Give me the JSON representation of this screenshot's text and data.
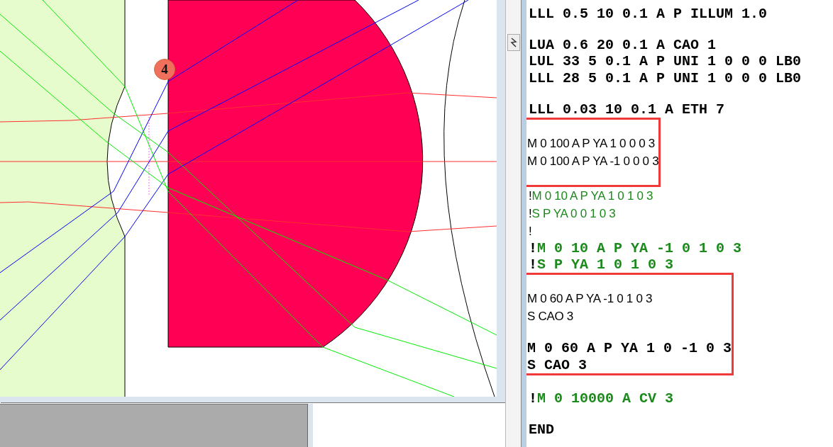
{
  "drawing_window": {
    "badge": "4"
  },
  "editor": {
    "blocks": [
      {
        "kind": "code",
        "bold": true,
        "text": "LLL 0.5 10 0.1 A P ILLUM 1.0"
      },
      {
        "kind": "blank"
      },
      {
        "kind": "code",
        "bold": true,
        "text": "LUA 0.6 20 0.1 A CAO 1"
      },
      {
        "kind": "code",
        "bold": true,
        "text": "LUL 33 5 0.1 A P UNI 1 0 0 0 LB0"
      },
      {
        "kind": "code",
        "bold": true,
        "text": "LLL 28 5 0.1 A P UNI 1 0 0 0 LB0"
      },
      {
        "kind": "blank"
      },
      {
        "kind": "code",
        "bold": true,
        "text": "LLL 0.03 10 0.1 A ETH 7"
      },
      {
        "kind": "highlight",
        "lines": [
          {
            "kind": "blank"
          },
          {
            "kind": "code",
            "bold": false,
            "text": "M 0 100 A P YA 1 0 0 0 3"
          },
          {
            "kind": "code",
            "bold": false,
            "text": "M 0 100 A P YA -1 0 0 0 3"
          },
          {
            "kind": "blank"
          }
        ]
      },
      {
        "kind": "comment",
        "bold": false,
        "prefix": "!",
        "text": "M 0 10 A P YA 1 0 1 0 3"
      },
      {
        "kind": "comment",
        "bold": false,
        "prefix": "!",
        "text": "S P YA 0 0 1 0 3"
      },
      {
        "kind": "comment",
        "bold": false,
        "prefix": "!"
      },
      {
        "kind": "comment",
        "bold": true,
        "prefix": "!",
        "text": "M 0 10 A P YA -1 0 1 0 3"
      },
      {
        "kind": "comment",
        "bold": true,
        "prefix": "!",
        "text": "S P YA 1 0 1 0 3"
      },
      {
        "kind": "highlight",
        "lines": [
          {
            "kind": "blank"
          },
          {
            "kind": "code",
            "bold": false,
            "text": "M 0 60 A P YA -1 0 1 0 3"
          },
          {
            "kind": "code",
            "bold": false,
            "text": "S CAO 3"
          },
          {
            "kind": "blank"
          },
          {
            "kind": "code",
            "bold": true,
            "text": "M 0 60 A P YA 1 0 -1 0 3"
          },
          {
            "kind": "code",
            "bold": true,
            "text": "S CAO 3"
          }
        ]
      },
      {
        "kind": "blank"
      },
      {
        "kind": "comment",
        "bold": true,
        "prefix": "!",
        "text": "M 0 10000 A CV 3"
      },
      {
        "kind": "blank"
      },
      {
        "kind": "code",
        "bold": true,
        "text": "END"
      }
    ]
  }
}
